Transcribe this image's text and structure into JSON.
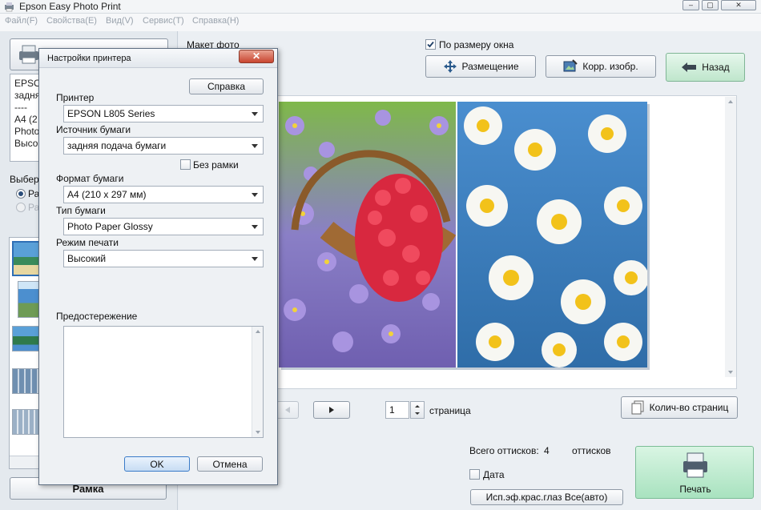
{
  "window": {
    "title": "Epson Easy Photo Print"
  },
  "menu": [
    "Файл(F)",
    "Свойства(E)",
    "Вид(V)",
    "Сервис(T)",
    "Справка(H)"
  ],
  "sidebar": {
    "info_lines": [
      "EPSO",
      "задня",
      "----",
      "A4 (2",
      "Photo",
      "Высо"
    ],
    "select_label": "Выбер",
    "radio1": "Ра",
    "radio2": "Ра",
    "frame_button": "Рамка"
  },
  "main": {
    "layout_label": "Макет фото",
    "fit_window_label": "По размеру окна",
    "fit_window_checked": true,
    "placement_button": "Размещение",
    "correct_button": "Корр. изобр.",
    "back_button": "Назад",
    "page_value": "1",
    "page_label": "страница",
    "pages_count_button": "Колич-во страниц",
    "total_prints_label": "Всего оттисков:",
    "total_prints_value": "4",
    "total_prints_unit": "оттисков",
    "date_label": "Дата",
    "red_eye_button": "Исп.эф.крас.глаз Все(авто)",
    "print_button": "Печать"
  },
  "dialog": {
    "title": "Настройки принтера",
    "help_button": "Справка",
    "printer_label": "Принтер",
    "printer_value": "EPSON L805 Series",
    "paper_source_label": "Источник бумаги",
    "paper_source_value": "задняя подача бумаги",
    "borderless_label": "Без рамки",
    "paper_size_label": "Формат бумаги",
    "paper_size_value": "A4 (210 x 297 мм)",
    "paper_type_label": "Тип бумаги",
    "paper_type_value": "Photo Paper Glossy",
    "print_mode_label": "Режим печати",
    "print_mode_value": "Высокий",
    "warning_label": "Предостережение",
    "ok_button": "OK",
    "cancel_button": "Отмена"
  },
  "colors": {
    "accent_green": "#a8e2bf",
    "close_red": "#c8452f"
  }
}
